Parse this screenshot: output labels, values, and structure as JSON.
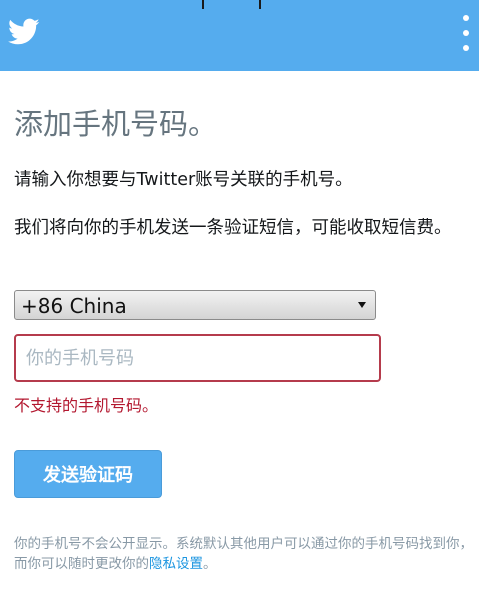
{
  "header": {
    "logo": "twitter-bird-icon",
    "menu_icon": "more-vertical-icon",
    "bg_color": "#55acee"
  },
  "main": {
    "title": "添加手机号码。",
    "instruction": "请输入你想要与Twitter账号关联的手机号。",
    "sms_notice": "我们将向你的手机发送一条验证短信，可能收取短信费。",
    "country_select": {
      "value": "+86 China"
    },
    "phone_input": {
      "placeholder": "你的手机号码",
      "value": ""
    },
    "error_message": "不支持的手机号码。",
    "error_color": "#b3172f",
    "send_button_label": "发送验证码",
    "privacy_note": "你的手机号不会公开显示。系统默认其他用户可以通过你的手机号码找到你，而你可以随时更改你的",
    "privacy_link_label": "隐私设置",
    "privacy_note_end": "。"
  }
}
